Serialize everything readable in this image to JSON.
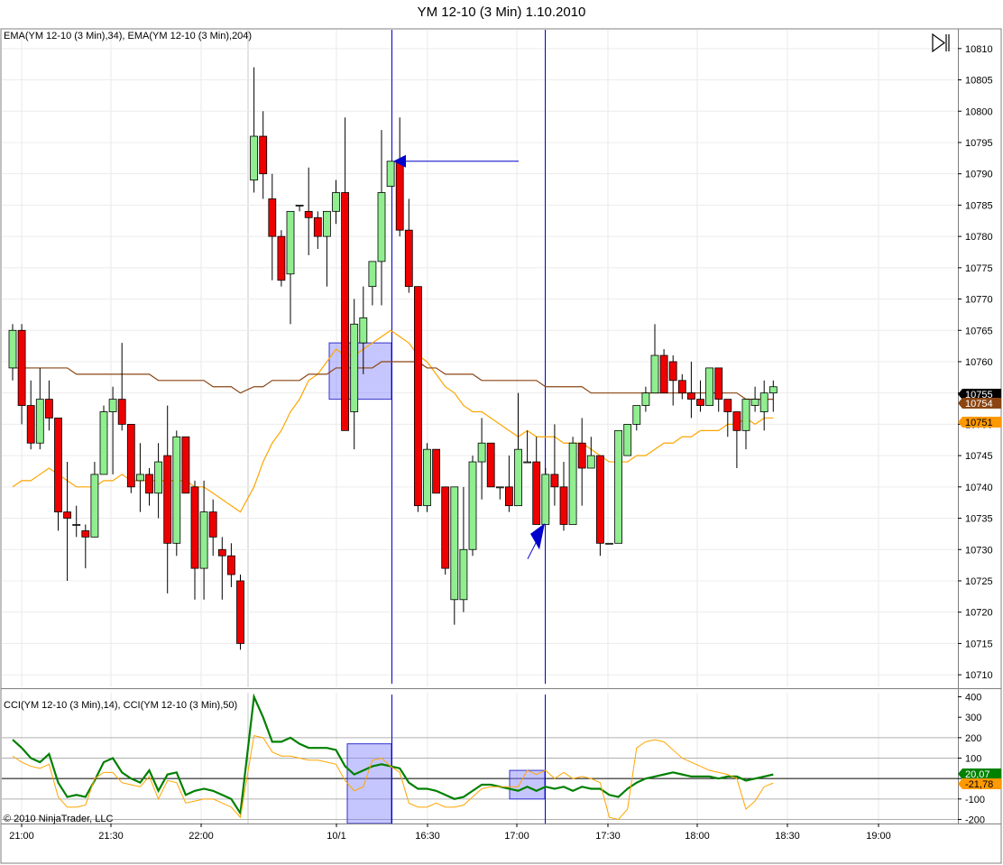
{
  "title": "YM 12-10 (3 Min)  1.10.2010",
  "copyright": "© 2010 NinjaTrader, LLC",
  "chart_data": [
    {
      "type": "candlestick",
      "panel": "price",
      "indicator_label": "EMA(YM 12-10 (3 Min),34), EMA(YM 12-10 (3 Min),204)",
      "ylim": [
        10708,
        10813
      ],
      "y_ticks": [
        10810,
        10805,
        10800,
        10795,
        10790,
        10785,
        10780,
        10775,
        10770,
        10765,
        10760,
        10755,
        10750,
        10745,
        10740,
        10735,
        10730,
        10725,
        10720,
        10715,
        10710
      ],
      "price_badges": [
        {
          "text": "10755",
          "value": 10755,
          "color": "#000000",
          "text_color": "#ffffff"
        },
        {
          "text": "10754",
          "value": 10754,
          "color": "#8b4513",
          "text_color": "#ffffff"
        },
        {
          "text": "10751",
          "value": 10751,
          "color": "#ff9900",
          "text_color": "#000000"
        }
      ],
      "up_color": "#90ee90",
      "down_color": "#ee0000",
      "ohlc": [
        [
          10759,
          10766,
          10757,
          10765
        ],
        [
          10765,
          10766,
          10750,
          10753
        ],
        [
          10753,
          10757,
          10746,
          10747
        ],
        [
          10747,
          10759,
          10746,
          10754
        ],
        [
          10754,
          10757,
          10749,
          10751
        ],
        [
          10751,
          10751,
          10733,
          10736
        ],
        [
          10736,
          10744,
          10725,
          10735
        ],
        [
          10734,
          10737,
          10732,
          10734
        ],
        [
          10733,
          10734,
          10727,
          10732
        ],
        [
          10732,
          10744,
          10732,
          10742
        ],
        [
          10742,
          10753,
          10742,
          10752
        ],
        [
          10752,
          10756,
          10742,
          10754
        ],
        [
          10754,
          10763,
          10749,
          10750
        ],
        [
          10750,
          10750,
          10739,
          10740
        ],
        [
          10741,
          10747,
          10736,
          10742
        ],
        [
          10742,
          10743,
          10737,
          10739
        ],
        [
          10739,
          10747,
          10735,
          10744
        ],
        [
          10745,
          10753,
          10723,
          10731
        ],
        [
          10731,
          10749,
          10729,
          10748
        ],
        [
          10748,
          10748,
          10739,
          10739
        ],
        [
          10740,
          10741,
          10722,
          10727
        ],
        [
          10727,
          10741,
          10722,
          10736
        ],
        [
          10736,
          10738,
          10729,
          10732
        ],
        [
          10730,
          10732,
          10722,
          10729
        ],
        [
          10729,
          10731,
          10724,
          10726
        ],
        [
          10725,
          10726,
          10714,
          10715
        ],
        [
          10789,
          10807,
          10787,
          10796
        ],
        [
          10796,
          10800,
          10786,
          10790
        ],
        [
          10786,
          10790,
          10773,
          10780
        ],
        [
          10780,
          10781,
          10772,
          10773
        ],
        [
          10774,
          10783,
          10766,
          10784
        ],
        [
          10785,
          10785,
          10784,
          10785
        ],
        [
          10784,
          10791,
          10777,
          10783
        ],
        [
          10783,
          10784,
          10778,
          10780
        ],
        [
          10780,
          10784,
          10772,
          10784
        ],
        [
          10784,
          10789,
          10782,
          10787
        ],
        [
          10787,
          10799,
          10749,
          10749
        ],
        [
          10752,
          10770,
          10746,
          10766
        ],
        [
          10763,
          10772,
          10758,
          10767
        ],
        [
          10772,
          10776,
          10769,
          10776
        ],
        [
          10776,
          10797,
          10769,
          10787
        ],
        [
          10788,
          10792,
          10788,
          10792
        ],
        [
          10792,
          10799,
          10780,
          10781
        ],
        [
          10781,
          10786,
          10771,
          10772
        ],
        [
          10772,
          10772,
          10736,
          10737
        ],
        [
          10737,
          10747,
          10736,
          10746
        ],
        [
          10746,
          10746,
          10739,
          10739
        ],
        [
          10740,
          10740,
          10726,
          10727
        ],
        [
          10722,
          10740,
          10718,
          10740
        ],
        [
          10722,
          10740,
          10720,
          10730
        ],
        [
          10730,
          10745,
          10729,
          10744
        ],
        [
          10744,
          10751,
          10738,
          10747
        ],
        [
          10747,
          10747,
          10740,
          10740
        ],
        [
          10740,
          10740,
          10738,
          10740
        ],
        [
          10740,
          10745,
          10736,
          10737
        ],
        [
          10737,
          10755,
          10737,
          10746
        ],
        [
          10744,
          10749,
          10744,
          10744
        ],
        [
          10744,
          10748,
          10734,
          10734
        ],
        [
          10734,
          10743,
          10734,
          10742
        ],
        [
          10742,
          10750,
          10737,
          10740
        ],
        [
          10740,
          10744,
          10733,
          10734
        ],
        [
          10734,
          10748,
          10734,
          10747
        ],
        [
          10747,
          10751,
          10737,
          10743
        ],
        [
          10743,
          10748,
          10743,
          10745
        ],
        [
          10745,
          10745,
          10729,
          10731
        ],
        [
          10731,
          10731,
          10731,
          10731
        ],
        [
          10731,
          10748,
          10731,
          10749
        ],
        [
          10745,
          10750,
          10745,
          10750
        ],
        [
          10750,
          10753,
          10749,
          10753
        ],
        [
          10753,
          10756,
          10752,
          10755
        ],
        [
          10755,
          10766,
          10755,
          10761
        ],
        [
          10761,
          10762,
          10755,
          10755
        ],
        [
          10760,
          10761,
          10753,
          10757
        ],
        [
          10757,
          10758,
          10754,
          10755
        ],
        [
          10755,
          10760,
          10751,
          10754
        ],
        [
          10754,
          10757,
          10752,
          10753
        ],
        [
          10753,
          10759,
          10753,
          10759
        ],
        [
          10759,
          10759,
          10752,
          10754
        ],
        [
          10754,
          10754,
          10748,
          10752
        ],
        [
          10752,
          10752,
          10743,
          10749
        ],
        [
          10749,
          10750,
          10746,
          10754
        ],
        [
          10753,
          10756,
          10752,
          10754
        ],
        [
          10752,
          10757,
          10749,
          10755
        ],
        [
          10755,
          10757,
          10752,
          10756
        ]
      ],
      "series": [
        {
          "name": "EMA(YM 12-10 (3 Min),34)",
          "color": "#ffa500",
          "values": [
            10740,
            10741,
            10741,
            10742,
            10743,
            10742,
            10741,
            10740,
            10740,
            10740,
            10741,
            10741,
            10742,
            10741,
            10741,
            10741,
            10741,
            10741,
            10741,
            10741,
            10740,
            10740,
            10739,
            10738,
            10737,
            10736,
            10740,
            10744,
            10747,
            10749,
            10752,
            10754,
            10757,
            10758,
            10760,
            10762,
            10761,
            10761,
            10762,
            10763,
            10764,
            10765,
            10764,
            10763,
            10761,
            10760,
            10758,
            10756,
            10755,
            10753,
            10752,
            10752,
            10751,
            10750,
            10749,
            10748,
            10749,
            10748,
            10748,
            10748,
            10747,
            10747,
            10747,
            10746,
            10745,
            10744,
            10744,
            10744,
            10745,
            10745,
            10746,
            10747,
            10747,
            10748,
            10748,
            10749,
            10749,
            10749,
            10750,
            10750,
            10751,
            10750,
            10751,
            10751
          ]
        },
        {
          "name": "EMA(YM 12-10 (3 Min),204)",
          "color": "#8b4513",
          "values": [
            10759,
            10759,
            10759,
            10759,
            10759,
            10759,
            10759,
            10758,
            10758,
            10758,
            10758,
            10758,
            10758,
            10758,
            10758,
            10758,
            10757,
            10757,
            10757,
            10757,
            10757,
            10757,
            10756,
            10756,
            10756,
            10755,
            10756,
            10756,
            10757,
            10757,
            10757,
            10757,
            10758,
            10758,
            10758,
            10759,
            10759,
            10759,
            10759,
            10759,
            10760,
            10760,
            10760,
            10760,
            10760,
            10759,
            10759,
            10758,
            10758,
            10758,
            10758,
            10757,
            10757,
            10757,
            10757,
            10757,
            10757,
            10757,
            10756,
            10756,
            10756,
            10756,
            10756,
            10755,
            10755,
            10755,
            10755,
            10755,
            10755,
            10755,
            10755,
            10755,
            10755,
            10755,
            10755,
            10755,
            10755,
            10755,
            10755,
            10755,
            10754,
            10754,
            10754,
            10754
          ]
        }
      ]
    },
    {
      "type": "line",
      "panel": "cci",
      "indicator_label": "CCI(YM 12-10 (3 Min),14), CCI(YM 12-10 (3 Min),50)",
      "ylim": [
        -220,
        420
      ],
      "y_ticks": [
        400,
        300,
        200,
        100,
        0,
        -100,
        -200
      ],
      "y_tick_labels": [
        "400",
        "300",
        "200",
        "100",
        "0",
        "-100",
        "-200"
      ],
      "reference_lines": [
        200,
        100,
        0,
        -100,
        -200
      ],
      "value_badges": [
        {
          "text": "20,07",
          "value": 20,
          "color": "#008000",
          "text_color": "#ffffff"
        },
        {
          "text": "-21,78",
          "value": -22,
          "color": "#ff9900",
          "text_color": "#000000"
        }
      ],
      "series": [
        {
          "name": "CCI(YM 12-10 (3 Min),14)",
          "color": "#008000",
          "values": [
            190,
            150,
            100,
            80,
            120,
            -20,
            -90,
            -80,
            -90,
            -10,
            80,
            100,
            30,
            0,
            -20,
            40,
            -60,
            20,
            30,
            -80,
            -60,
            -50,
            -60,
            -80,
            -100,
            -170,
            400,
            300,
            180,
            180,
            200,
            170,
            150,
            150,
            150,
            140,
            60,
            20,
            40,
            60,
            70,
            60,
            50,
            -20,
            -50,
            -50,
            -60,
            -80,
            -100,
            -90,
            -60,
            -30,
            -30,
            -40,
            -50,
            -60,
            -40,
            -60,
            -40,
            -50,
            -40,
            -60,
            -40,
            -50,
            -50,
            -80,
            -90,
            -50,
            -20,
            0,
            10,
            20,
            30,
            20,
            10,
            10,
            10,
            0,
            10,
            10,
            -10,
            0,
            10,
            20
          ]
        },
        {
          "name": "CCI(YM 12-10 (3 Min),50)",
          "color": "#ffa500",
          "values": [
            110,
            80,
            60,
            50,
            70,
            -90,
            -140,
            -140,
            -130,
            0,
            30,
            30,
            -20,
            -30,
            -40,
            10,
            -100,
            -10,
            -20,
            -120,
            -110,
            -100,
            -100,
            -120,
            -140,
            -190,
            210,
            200,
            130,
            110,
            110,
            100,
            90,
            90,
            80,
            70,
            -10,
            -60,
            -40,
            90,
            100,
            60,
            30,
            -120,
            -140,
            -140,
            -120,
            -140,
            -140,
            -130,
            -90,
            -50,
            -40,
            -40,
            -40,
            -40,
            40,
            20,
            40,
            0,
            30,
            0,
            10,
            0,
            -20,
            -190,
            -200,
            -150,
            150,
            180,
            190,
            180,
            140,
            100,
            80,
            60,
            40,
            30,
            20,
            0,
            -150,
            -110,
            -40,
            -22
          ]
        }
      ]
    }
  ],
  "x_axis": {
    "labels": [
      "21:00",
      "21:30",
      "22:00",
      "10/1",
      "16:30",
      "17:00",
      "17:30",
      "18:00",
      "18:30",
      "19:00"
    ]
  },
  "annotations": {
    "markers": [
      "horizontal-arrow",
      "diagonal-arrow"
    ],
    "highlight_color": "#8080ff"
  },
  "icons": {
    "scroll_end": "skip-to-end-icon"
  }
}
